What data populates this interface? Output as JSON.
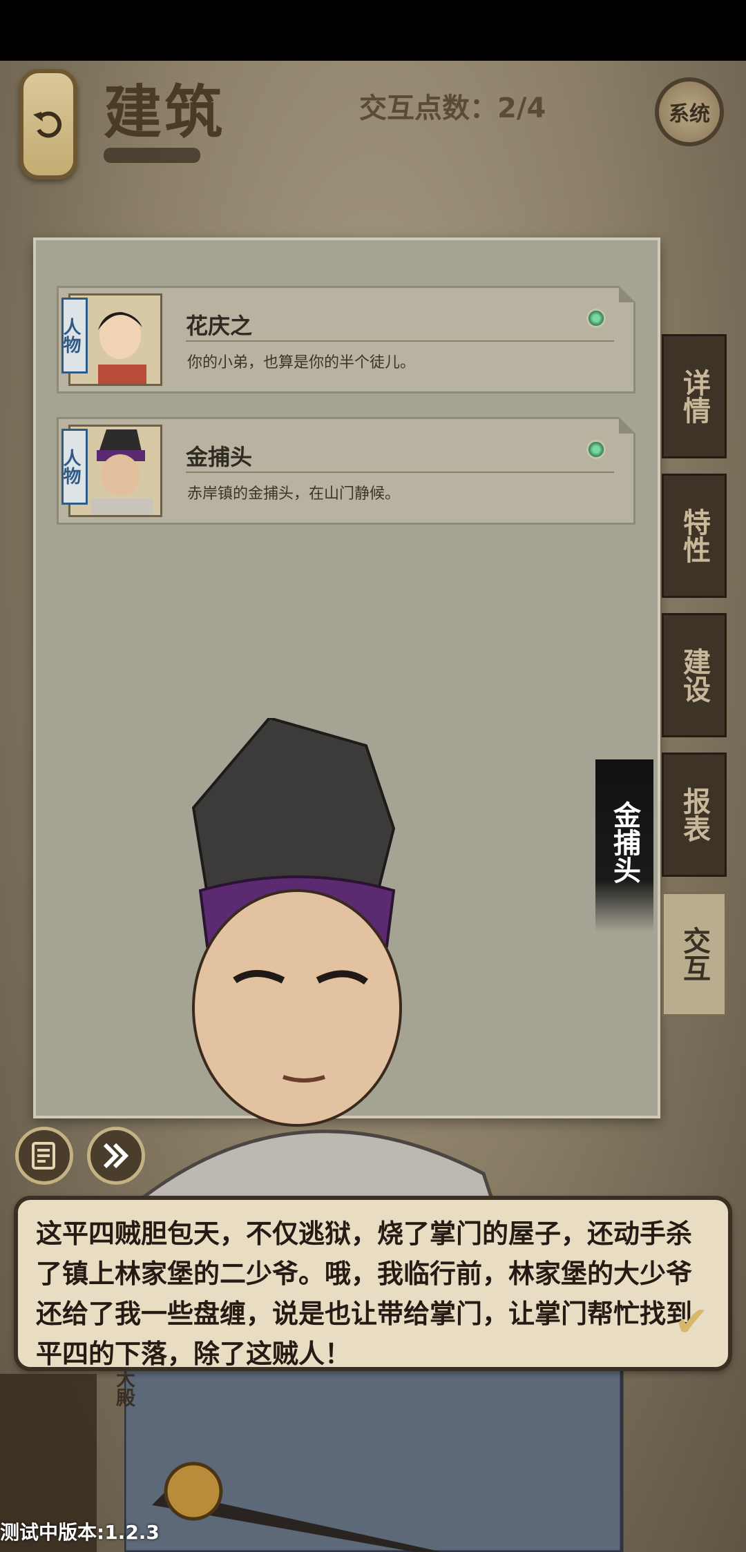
{
  "header": {
    "title": "建筑",
    "points_label": "交互点数：2/4",
    "system_label": "系统"
  },
  "cards": [
    {
      "tag": "人物",
      "name": "花庆之",
      "desc": "你的小弟，也算是你的半个徒儿。"
    },
    {
      "tag": "人物",
      "name": "金捕头",
      "desc": "赤岸镇的金捕头，在山门静候。"
    }
  ],
  "side_tabs": [
    "详情",
    "特性",
    "建设",
    "报表",
    "交互"
  ],
  "active_tab": "交互",
  "speaker": "金捕头",
  "dialog": "这平四贼胆包天，不仅逃狱，烧了掌门的屋子，还动手杀了镇上林家堡的二少爷。哦，我临行前，林家堡的大少爷还给了我一些盘缠，说是也让带给掌门，让掌门帮忙找到平四的下落，除了这贼人！",
  "bottom": {
    "label": "大殿"
  },
  "version": "测试中版本:1.2.3"
}
